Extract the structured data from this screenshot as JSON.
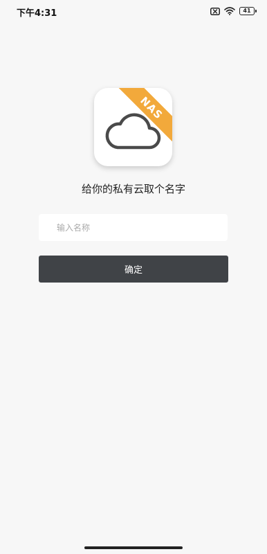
{
  "status_bar": {
    "time": "下午4:31",
    "battery_level": "41",
    "icons": [
      "sim-off-icon",
      "wifi-icon",
      "battery-icon"
    ]
  },
  "app_icon": {
    "badge": "NAS",
    "icon": "cloud-icon",
    "badge_color": "#f2a93b"
  },
  "headline": "给你的私有云取个名字",
  "name_input": {
    "placeholder": "输入名称",
    "value": ""
  },
  "confirm_button": {
    "label": "确定",
    "color": "#404347"
  }
}
